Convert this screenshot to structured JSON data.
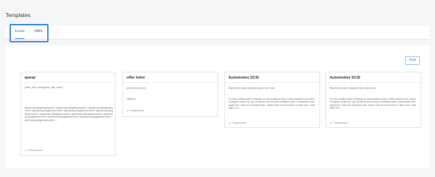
{
  "page": {
    "title": "Templates"
  },
  "tabs": [
    {
      "label": "Email",
      "active": true
    },
    {
      "label": "SMS",
      "active": false
    }
  ],
  "toolbar": {
    "add_label": "Add"
  },
  "accent_color": "#3a8be8",
  "cards": [
    {
      "title": "qweqr",
      "lines": [
        "{client_first_name}{client_last_name}"
      ],
      "body": "qwertyuiop;lkjhgfdsazxcvbnm,./qwertyuiop;lkjhgfdsazxcvbnm,./qwertyuiop;lkjhgfdsazxcvbnm,./qwertyuiop;lkjhgfdsazxcvbnm,./qwertyuiop;lkjhgfdsazxcvbnm,./qwertyuiop;lkjhgfdsazxcvbnm,./qwertyuiop;lkjhgfdsazxcvbnm,./qwertyuiop;lkjhgfdsazxcvbnm,./qwertyuiop;lkjhgfdsazxcvbnm,./qwertyuiop;lkjhgfdsazxcvbnm,./qwertyuiop;lkjhgfdsazxcvbnm,./qwertyuiop;lkjhgfdsazxcvbnm,./",
      "attachments": "0 Attachment"
    },
    {
      "title": "offer letter",
      "lines": [
        "{client_first_name}",
        "sdfsdsdf"
      ],
      "body": "",
      "attachments": "0 Attachment"
    },
    {
      "title": "Automotive SCSI",
      "lines": [
        "Repellat nisi optio voluptate earum illum eum.",
        "Et nobis mollitia autem molestias ut necessitatibus vitae. Dolore repellat eum autem numquam neque est. Qui architecto vero tempore similique quam consequatur eum asperiores. Esse non provident nam. Neque nihil aut commodi ut et vitae sunt. Unde ullam non."
      ],
      "body": "",
      "attachments": "1 Attachment"
    },
    {
      "title": "Automotive SCSI",
      "lines": [
        "Repellat nisi optio voluptate earum illum eum.",
        "Et nobis mollitia autem molestias ut necessitatibus vitae. Dolore repellat eum autem numquam neque est. Qui architecto vero tempore similique quam consequatur eum asperiores. Esse non provident nam. Neque nihil aut commodi ut et vitae sunt. Unde ullam non."
      ],
      "body": "",
      "attachments": "7 Attachment"
    }
  ]
}
